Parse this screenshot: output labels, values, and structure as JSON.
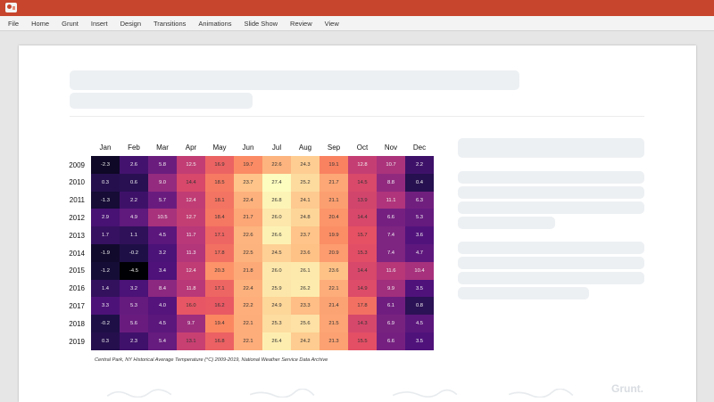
{
  "menu": [
    "File",
    "Home",
    "Grunt",
    "Insert",
    "Design",
    "Transitions",
    "Animations",
    "Slide Show",
    "Review",
    "View"
  ],
  "logo_text": "Grunt.",
  "caption": "Central Park, NY Historical Average Temperature (°C) 2009-2019, National Weather Service Data Archive",
  "chart_data": {
    "type": "heatmap",
    "x_categories": [
      "Jan",
      "Feb",
      "Mar",
      "Apr",
      "May",
      "Jun",
      "Jul",
      "Aug",
      "Sep",
      "Oct",
      "Nov",
      "Dec"
    ],
    "y_categories": [
      "2009",
      "2010",
      "2011",
      "2012",
      "2013",
      "2014",
      "2015",
      "2016",
      "2017",
      "2018",
      "2019"
    ],
    "values": [
      [
        -2.3,
        2.6,
        5.8,
        12.5,
        16.9,
        19.7,
        22.6,
        24.3,
        19.1,
        12.8,
        10.7,
        2.2
      ],
      [
        0.3,
        0.6,
        9.0,
        14.4,
        18.5,
        23.7,
        27.4,
        25.2,
        21.7,
        14.5,
        8.8,
        0.4
      ],
      [
        -1.3,
        2.2,
        5.7,
        12.4,
        18.1,
        22.4,
        26.8,
        24.1,
        21.1,
        13.9,
        11.1,
        6.3
      ],
      [
        2.9,
        4.9,
        10.5,
        12.7,
        18.4,
        21.7,
        26.0,
        24.8,
        20.4,
        14.4,
        6.6,
        5.3
      ],
      [
        1.7,
        1.1,
        4.5,
        11.7,
        17.1,
        22.6,
        26.6,
        23.7,
        19.9,
        15.7,
        7.4,
        3.6
      ],
      [
        -1.9,
        -0.2,
        3.2,
        11.3,
        17.8,
        22.5,
        24.5,
        23.6,
        20.9,
        15.3,
        7.4,
        4.7
      ],
      [
        -1.2,
        -4.5,
        3.4,
        12.4,
        20.3,
        21.8,
        26.0,
        26.1,
        23.6,
        14.4,
        11.6,
        10.4
      ],
      [
        1.4,
        3.2,
        8.4,
        11.8,
        17.1,
        22.4,
        25.9,
        26.2,
        22.1,
        14.9,
        9.9,
        3.5
      ],
      [
        3.3,
        5.3,
        4.0,
        16.0,
        16.2,
        22.2,
        24.9,
        23.3,
        21.4,
        17.8,
        6.1,
        0.8
      ],
      [
        -0.2,
        5.6,
        4.5,
        9.7,
        19.4,
        22.1,
        25.3,
        25.6,
        21.5,
        14.3,
        6.9,
        4.5
      ],
      [
        0.3,
        2.3,
        5.4,
        13.1,
        16.8,
        22.1,
        26.4,
        24.2,
        21.3,
        15.5,
        6.6,
        3.5
      ]
    ],
    "colormap": "magma",
    "vmin": -4.5,
    "vmax": 27.4
  }
}
